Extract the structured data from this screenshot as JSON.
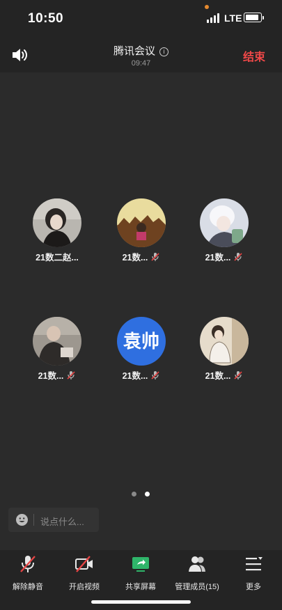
{
  "status_bar": {
    "time": "10:50",
    "network": "LTE"
  },
  "header": {
    "title": "腾讯会议",
    "duration": "09:47",
    "end_label": "结束"
  },
  "participants": [
    {
      "name": "21数二赵...",
      "muted": false,
      "avatar": "photo"
    },
    {
      "name": "21数...",
      "muted": true,
      "avatar": "photo"
    },
    {
      "name": "21数...",
      "muted": true,
      "avatar": "photo"
    },
    {
      "name": "21数...",
      "muted": true,
      "avatar": "photo"
    },
    {
      "name": "21数...",
      "muted": true,
      "avatar_text": "袁帅"
    },
    {
      "name": "21数...",
      "muted": true,
      "avatar": "photo"
    }
  ],
  "pagination": {
    "total": 2,
    "current": 2
  },
  "chat": {
    "placeholder": "说点什么..."
  },
  "toolbar": {
    "unmute": "解除静音",
    "video": "开启视频",
    "share": "共享屏幕",
    "members": "管理成员(15)",
    "more": "更多"
  },
  "colors": {
    "end_red": "#f04848",
    "share_green": "#2fb56a",
    "avatar_blue": "#2f6fe0"
  }
}
